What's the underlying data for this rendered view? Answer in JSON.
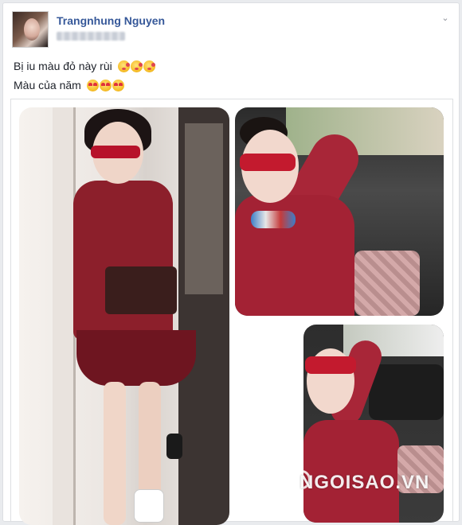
{
  "post": {
    "author_name": "Trangnhung Nguyen",
    "lines": [
      "Bị iu màu đỏ này rùi",
      "Màu của năm"
    ],
    "line_emojis": [
      [
        "kissing-heart-emoji",
        "kissing-heart-emoji",
        "kissing-heart-emoji"
      ],
      [
        "heart-eyes-emoji",
        "heart-eyes-emoji",
        "heart-eyes-emoji"
      ]
    ],
    "options_icon": "chevron-down-icon",
    "options_glyph": "⌄"
  },
  "gallery": {
    "photos": [
      {
        "name": "photo-mirror-selfie"
      },
      {
        "name": "photo-car-selfie-1"
      },
      {
        "name": "photo-car-selfie-2"
      }
    ],
    "watermark": "NGOISAO.VN"
  },
  "colors": {
    "link": "#365899",
    "dress": "#a32234",
    "background": "#e9ebee"
  }
}
